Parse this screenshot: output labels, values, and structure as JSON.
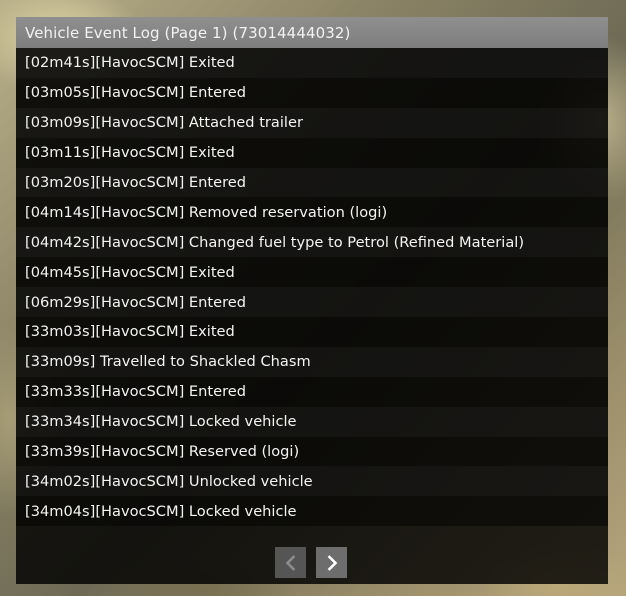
{
  "window": {
    "title": "Vehicle Event Log (Page 1) (73014444032)"
  },
  "log": {
    "entries": [
      "[02m41s][HavocSCM] Exited",
      "[03m05s][HavocSCM] Entered",
      "[03m09s][HavocSCM] Attached trailer",
      "[03m11s][HavocSCM] Exited",
      "[03m20s][HavocSCM] Entered",
      "[04m14s][HavocSCM] Removed reservation (logi)",
      "[04m42s][HavocSCM] Changed fuel type to Petrol (Refined Material)",
      "[04m45s][HavocSCM] Exited",
      "[06m29s][HavocSCM] Entered",
      "[33m03s][HavocSCM] Exited",
      "[33m09s] Travelled to Shackled Chasm",
      "[33m33s][HavocSCM] Entered",
      "[33m34s][HavocSCM] Locked vehicle",
      "[33m39s][HavocSCM] Reserved (logi)",
      "[34m02s][HavocSCM] Unlocked vehicle",
      "[34m04s][HavocSCM] Locked vehicle"
    ]
  },
  "pager": {
    "prev_icon": "chevron-left-icon",
    "next_icon": "chevron-right-icon",
    "prev_enabled": false,
    "next_enabled": true
  },
  "colors": {
    "titlebar": "#8a8a8a",
    "text": "#f4f4f4",
    "button": "#6d6d6d",
    "button_disabled": "#555555"
  }
}
